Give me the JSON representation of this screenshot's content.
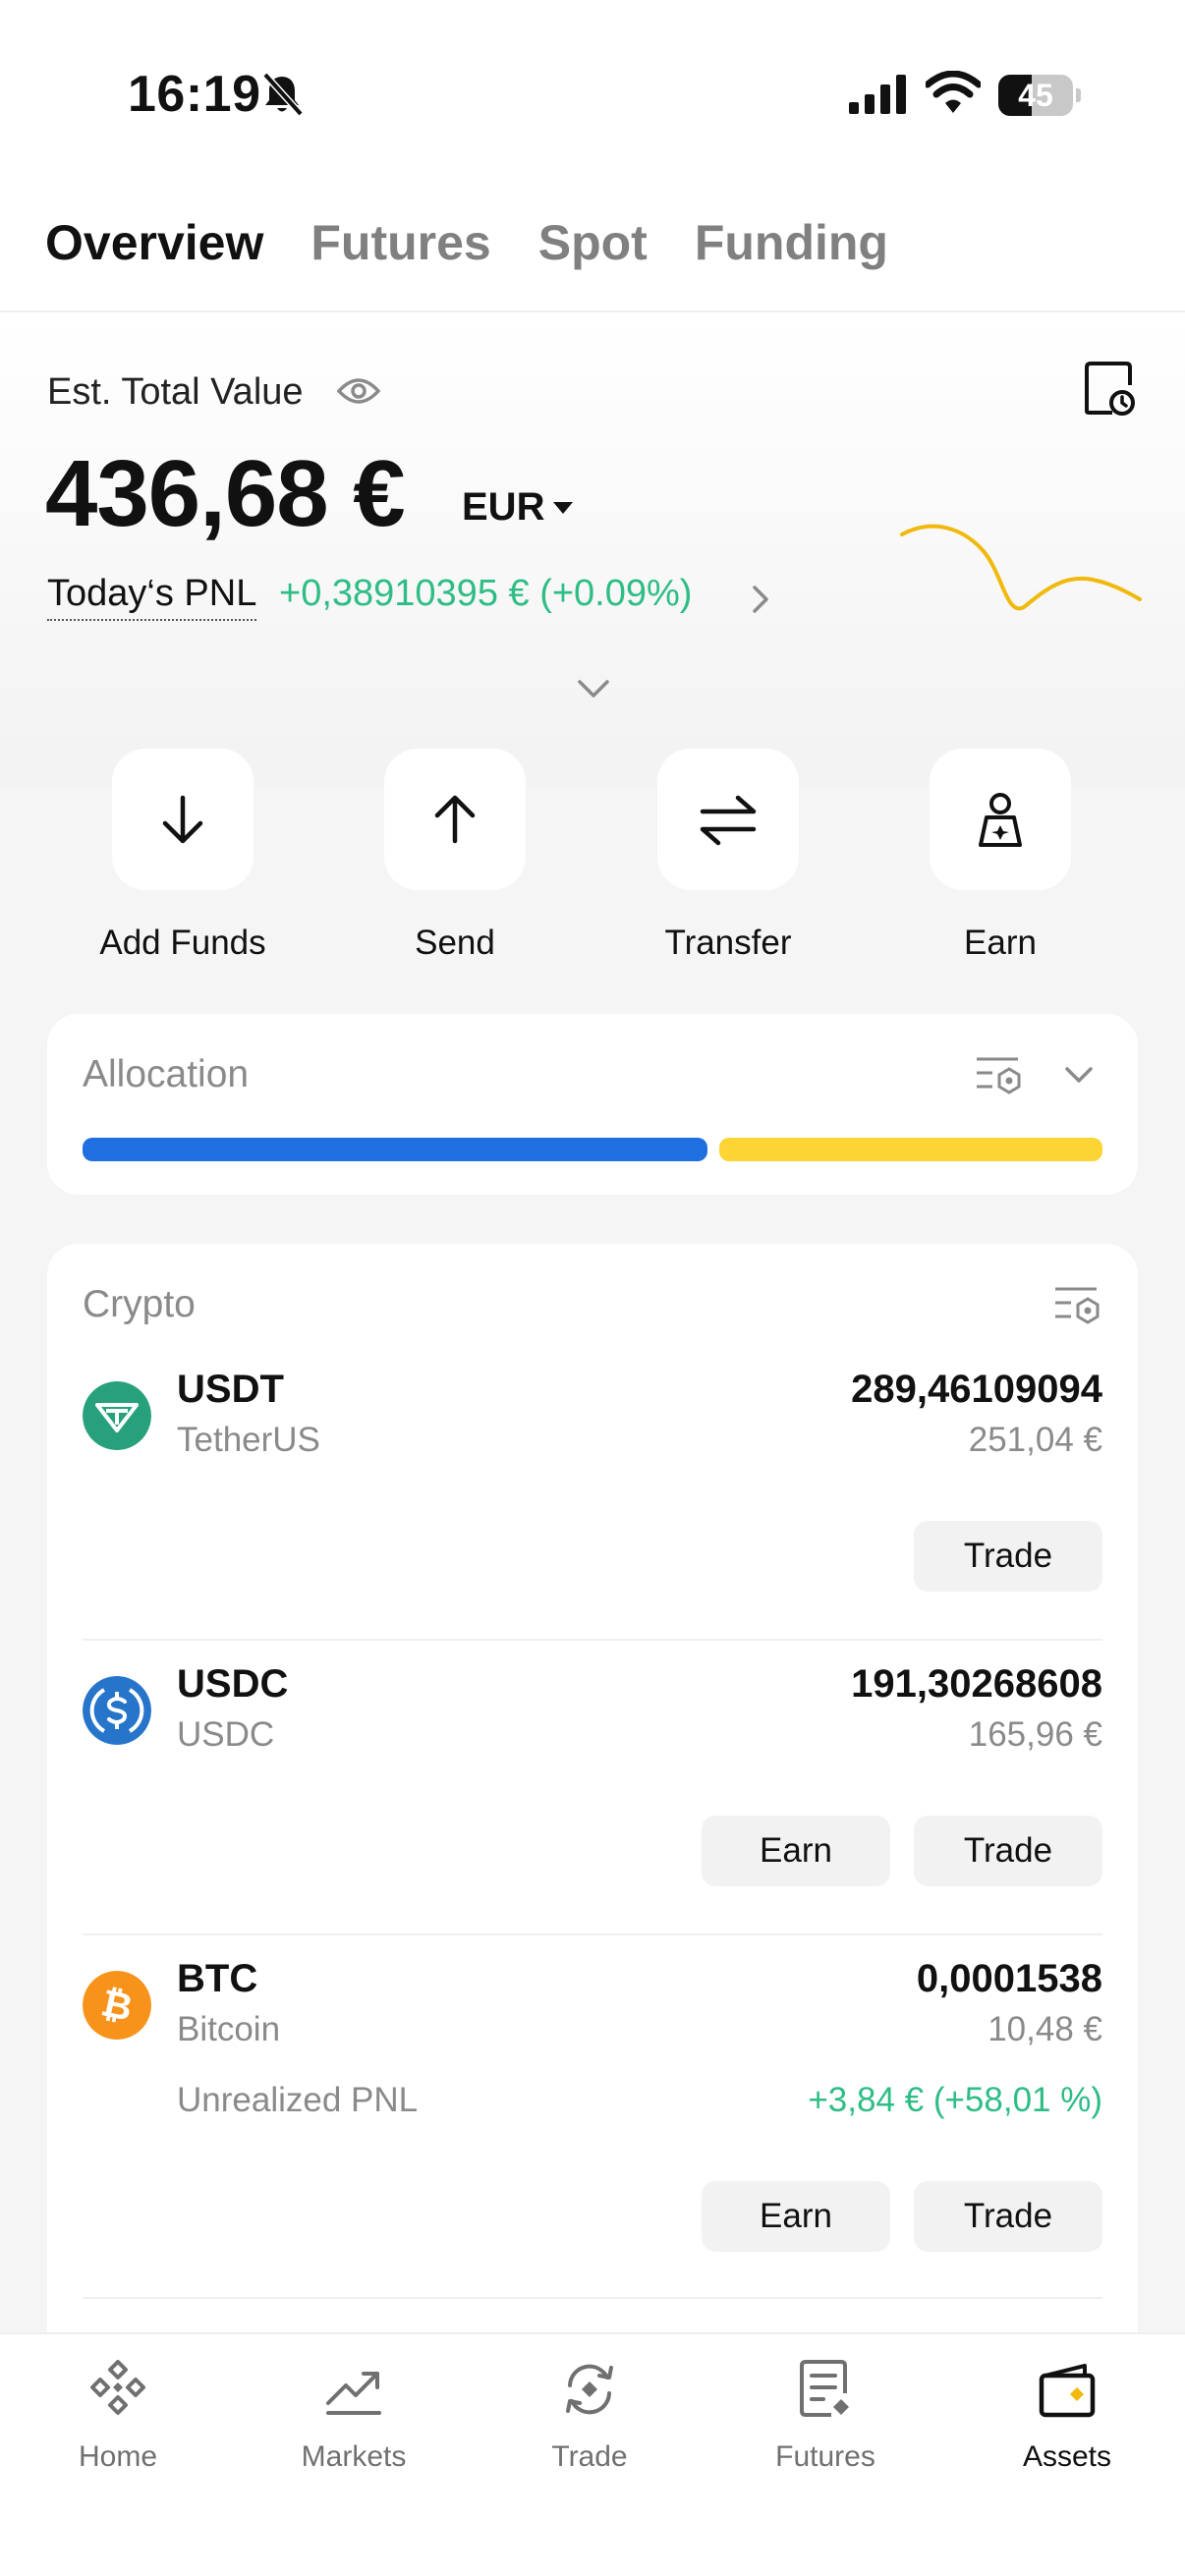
{
  "status_bar": {
    "time": "16:19",
    "battery": "45"
  },
  "tabs": [
    {
      "label": "Overview",
      "active": true
    },
    {
      "label": "Futures",
      "active": false
    },
    {
      "label": "Spot",
      "active": false
    },
    {
      "label": "Funding",
      "active": false
    }
  ],
  "overview": {
    "est_total_label": "Est. Total Value",
    "total_value": "436,68 €",
    "currency": "EUR",
    "pnl_label": "Today‘s PNL",
    "pnl_value": "+0,38910395 € (+0.09%)"
  },
  "actions": [
    {
      "label": "Add Funds",
      "icon": "arrow-down-icon"
    },
    {
      "label": "Send",
      "icon": "arrow-up-icon"
    },
    {
      "label": "Transfer",
      "icon": "transfer-icon"
    },
    {
      "label": "Earn",
      "icon": "earn-icon"
    }
  ],
  "allocation": {
    "title": "Allocation",
    "segments": [
      {
        "share": 0.62,
        "color": "#1f6fe0"
      },
      {
        "share": 0.38,
        "color": "#fcd535"
      }
    ]
  },
  "crypto": {
    "title": "Crypto",
    "assets": [
      {
        "symbol": "USDT",
        "name": "TetherUS",
        "amount": "289,46109094",
        "fiat": "251,04 €",
        "color": "#26a17b",
        "buttons": [
          "Trade"
        ]
      },
      {
        "symbol": "USDC",
        "name": "USDC",
        "amount": "191,30268608",
        "fiat": "165,96 €",
        "color": "#2775ca",
        "buttons": [
          "Earn",
          "Trade"
        ]
      },
      {
        "symbol": "BTC",
        "name": "Bitcoin",
        "amount": "0,0001538",
        "fiat": "10,48 €",
        "color": "#f7931a",
        "upnl_label": "Unrealized PNL",
        "upnl_value": "+3,84 € (+58,01 %)",
        "buttons": [
          "Earn",
          "Trade"
        ]
      }
    ]
  },
  "bottom_nav": [
    {
      "label": "Home",
      "icon": "home-diamond-icon"
    },
    {
      "label": "Markets",
      "icon": "markets-chart-icon"
    },
    {
      "label": "Trade",
      "icon": "trade-swap-icon"
    },
    {
      "label": "Futures",
      "icon": "futures-document-icon"
    },
    {
      "label": "Assets",
      "icon": "assets-wallet-icon",
      "active": true
    }
  ],
  "colors": {
    "positive": "#2ebd85",
    "accent": "#fcd535",
    "sparkline": "#f0b90b"
  }
}
